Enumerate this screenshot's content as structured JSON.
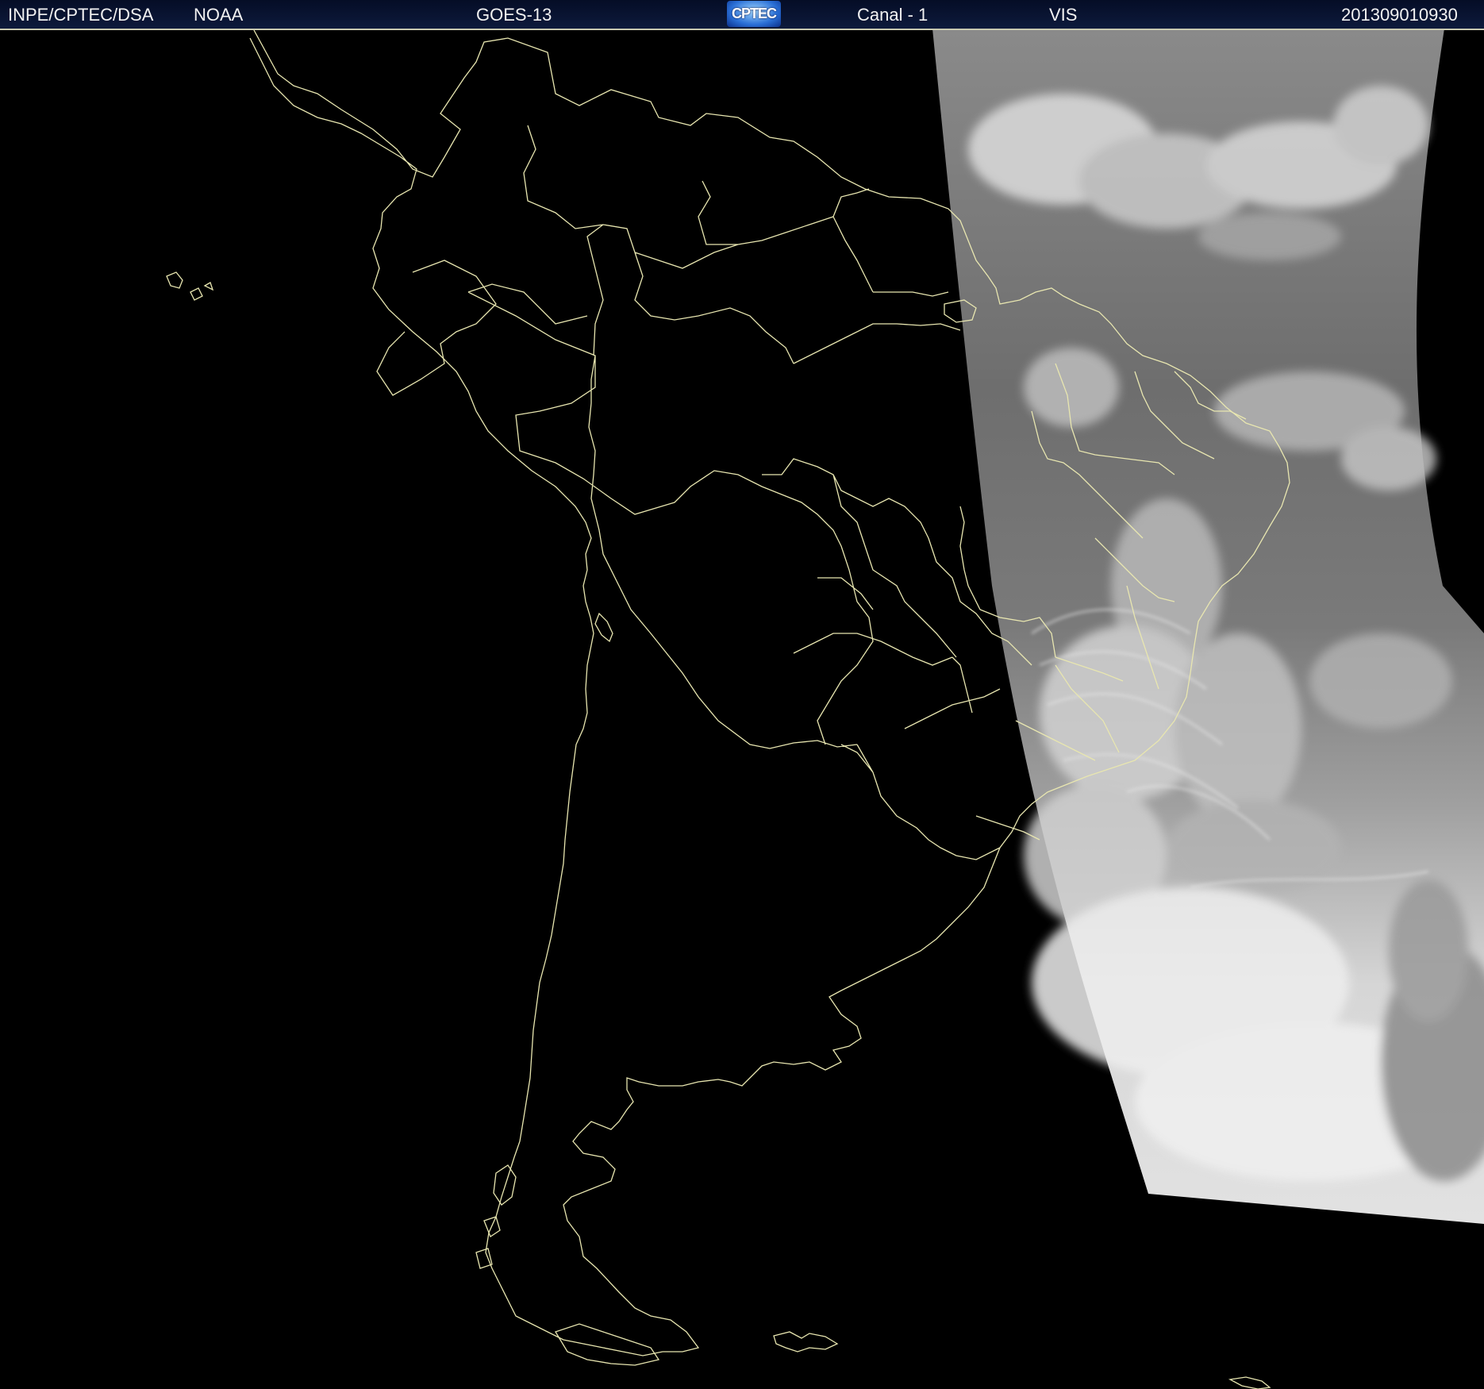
{
  "header": {
    "agency": "INPE/CPTEC/DSA",
    "provider": "NOAA",
    "satellite": "GOES-13",
    "logo_text": "CPTEC",
    "channel": "Canal - 1",
    "band": "VIS",
    "timestamp": "201309010930"
  },
  "map": {
    "background_color": "#000000",
    "border_color": "#e8e6b0",
    "region": "South America",
    "imagery": "visible-channel cloud cover (grayscale)"
  }
}
